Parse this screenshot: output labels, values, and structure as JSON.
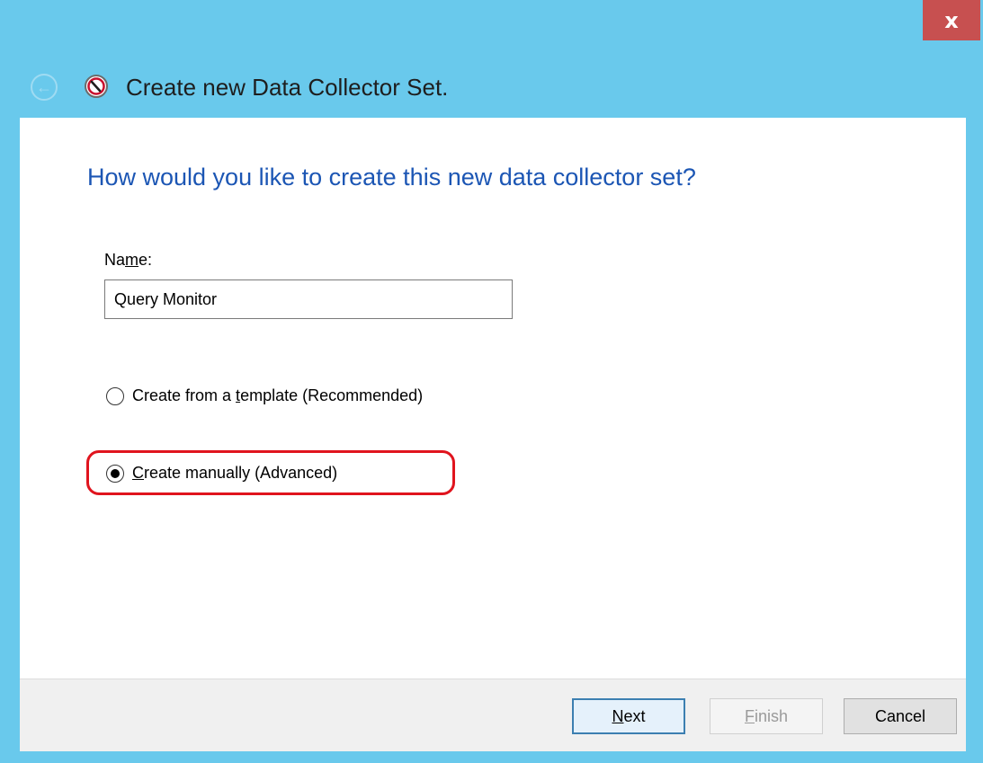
{
  "window": {
    "close_label": "x",
    "accent_color": "#69c9ec",
    "close_color": "#c75050"
  },
  "header": {
    "title": "Create new Data Collector Set."
  },
  "main": {
    "question": "How would you like to create this new data collector set?",
    "name_label_pre": "Na",
    "name_label_mnemonic": "m",
    "name_label_post": "e:",
    "name_value": "Query Monitor",
    "options": [
      {
        "label_pre": "Create from a ",
        "label_mnemonic": "t",
        "label_post": "emplate (Recommended)",
        "selected": false
      },
      {
        "label_pre": "",
        "label_mnemonic": "C",
        "label_post": "reate manually (Advanced)",
        "selected": true
      }
    ],
    "highlight_color": "#e0141e"
  },
  "footer": {
    "next_mnemonic": "N",
    "next_rest": "ext",
    "finish_mnemonic": "F",
    "finish_rest": "inish",
    "cancel_label": "Cancel"
  }
}
